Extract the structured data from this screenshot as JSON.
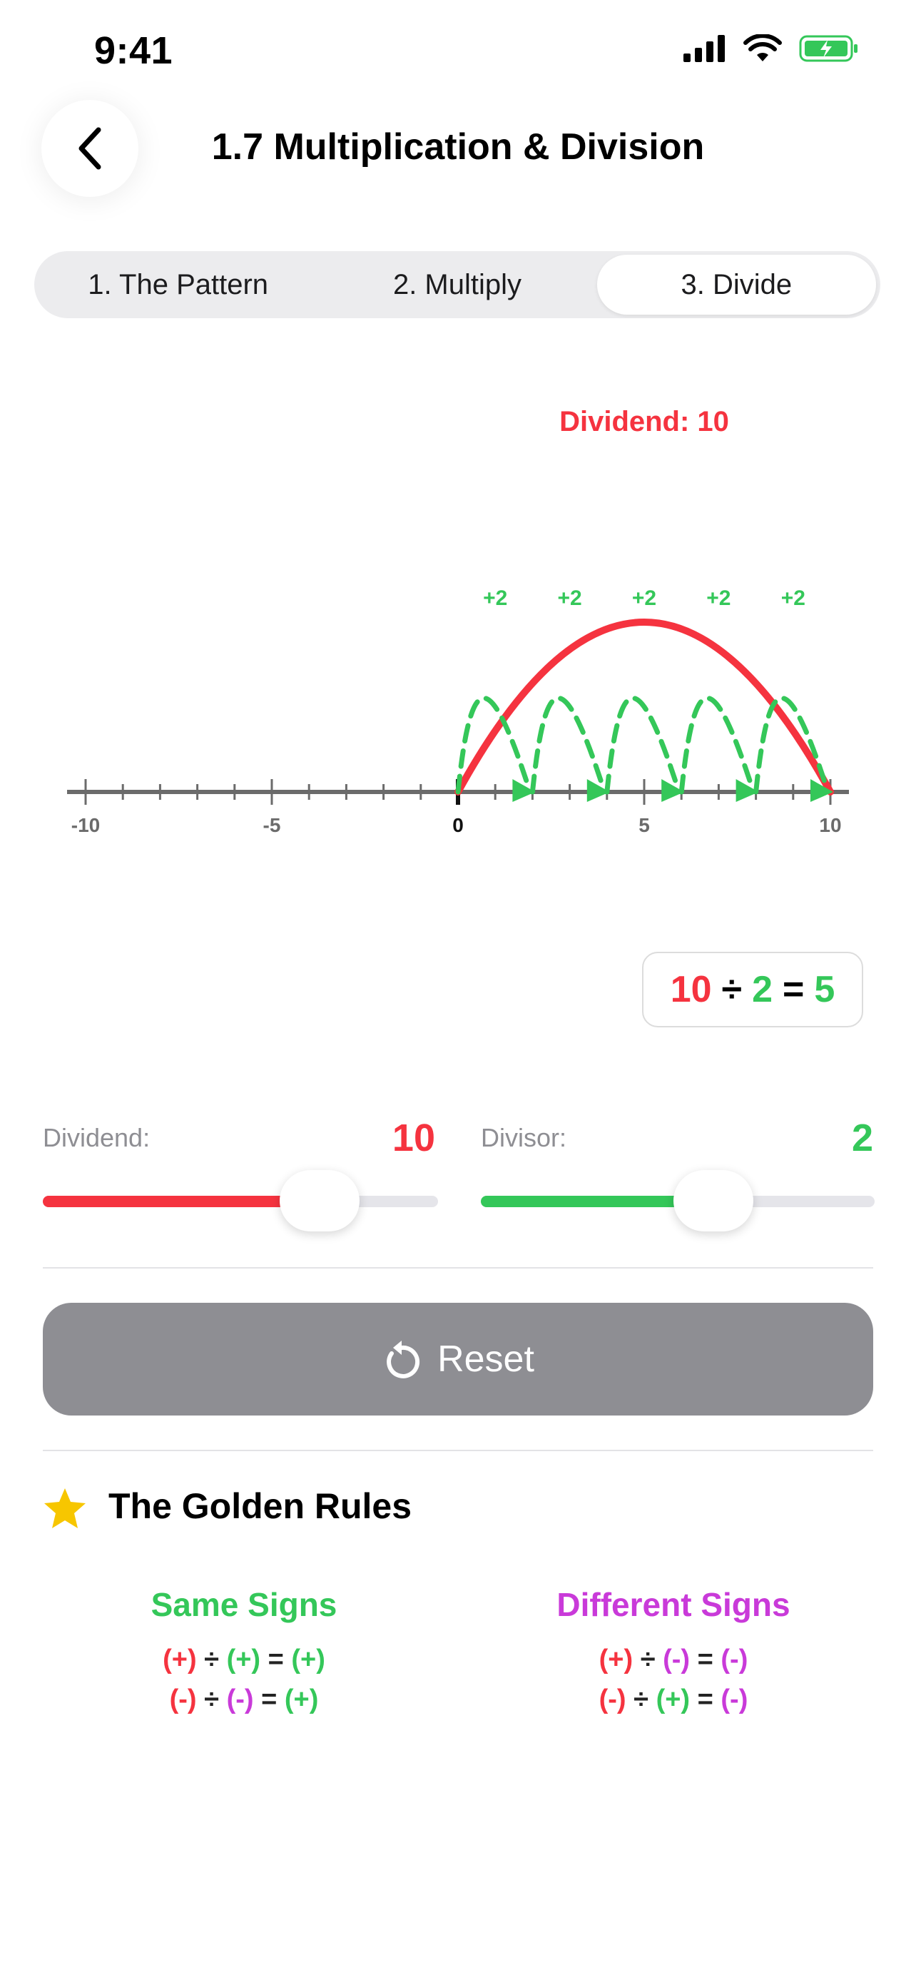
{
  "status": {
    "time": "9:41"
  },
  "header": {
    "title": "1.7 Multiplication & Division"
  },
  "tabs": [
    {
      "label": "1. The Pattern",
      "active": false
    },
    {
      "label": "2. Multiply",
      "active": false
    },
    {
      "label": "3. Divide",
      "active": true
    }
  ],
  "chart_data": {
    "type": "number-line",
    "title": "Dividend: 10",
    "xlim": [
      -10,
      10
    ],
    "tick_labels": [
      "-10",
      "-5",
      "0",
      "5",
      "10"
    ],
    "dividend_arc": {
      "from": 0,
      "to": 10,
      "color": "#f5333f"
    },
    "jumps": [
      {
        "from": 0,
        "to": 2,
        "label": "+2"
      },
      {
        "from": 2,
        "to": 4,
        "label": "+2"
      },
      {
        "from": 4,
        "to": 6,
        "label": "+2"
      },
      {
        "from": 6,
        "to": 8,
        "label": "+2"
      },
      {
        "from": 8,
        "to": 10,
        "label": "+2"
      }
    ],
    "jump_color": "#34c759"
  },
  "equation": {
    "dividend": "10",
    "op": "÷",
    "divisor": "2",
    "eq": "=",
    "result": "5"
  },
  "sliders": {
    "dividend": {
      "label": "Dividend:",
      "value": "10",
      "fraction": 0.7
    },
    "divisor": {
      "label": "Divisor:",
      "value": "2",
      "fraction": 0.59
    }
  },
  "reset": {
    "label": "Reset"
  },
  "rules": {
    "title": "The Golden Rules",
    "same": {
      "heading": "Same Signs",
      "lines": [
        [
          "(+)",
          "÷",
          "(+)",
          "=",
          "(+)"
        ],
        [
          "(-)",
          "÷",
          "(-)",
          "=",
          "(+)"
        ]
      ]
    },
    "different": {
      "heading": "Different Signs",
      "lines": [
        [
          "(+)",
          "÷",
          "(-)",
          "=",
          "(-)"
        ],
        [
          "(-)",
          "÷",
          "(+)",
          "=",
          "(-)"
        ]
      ]
    }
  }
}
